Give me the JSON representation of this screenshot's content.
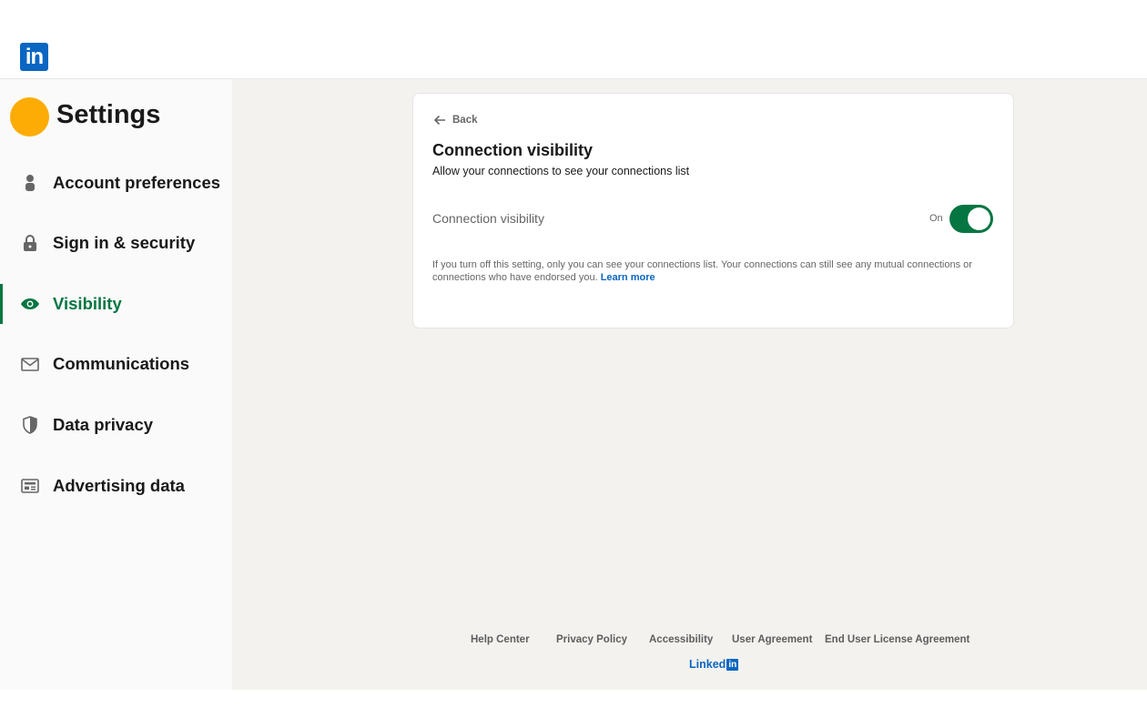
{
  "header": {
    "logo_text": "in"
  },
  "sidebar": {
    "title": "Settings",
    "avatar_color": "#fcac04",
    "items": [
      {
        "label": "Account preferences",
        "icon": "person-icon",
        "active": false
      },
      {
        "label": "Sign in & security",
        "icon": "lock-icon",
        "active": false
      },
      {
        "label": "Visibility",
        "icon": "eye-icon",
        "active": true
      },
      {
        "label": "Communications",
        "icon": "envelope-icon",
        "active": false
      },
      {
        "label": "Data privacy",
        "icon": "shield-icon",
        "active": false
      },
      {
        "label": "Advertising data",
        "icon": "ad-card-icon",
        "active": false
      }
    ]
  },
  "card": {
    "back_label": "Back",
    "title": "Connection visibility",
    "subtitle": "Allow your connections to see your connections list",
    "setting_label": "Connection visibility",
    "toggle_state": "On",
    "toggle_on": true,
    "help_text": "If you turn off this setting, only you can see your connections list. Your connections can still see any mutual connections or connections who have endorsed you.",
    "learn_more": "Learn more"
  },
  "footer": {
    "links": [
      "Help Center",
      "Privacy Policy",
      "Accessibility",
      "User Agreement",
      "End User License Agreement"
    ],
    "brand_word": "Linked",
    "brand_mark": "in"
  },
  "colors": {
    "brand_blue": "#0a66c2",
    "active_green": "#057642",
    "page_bg": "#f3f2ef"
  }
}
